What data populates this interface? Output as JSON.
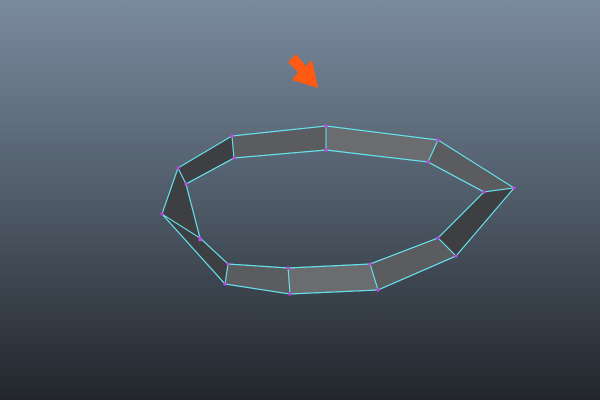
{
  "viewport": {
    "background_top": "#7A8A9E",
    "background_mid": "#4F5B68",
    "background_bottom": "#22262C"
  },
  "mesh": {
    "object": "polygon-ring",
    "segment_count": 12,
    "face_color": "#5A5C60",
    "face_shade_dark": "#3D3F42",
    "face_shade_light": "#6A6C70",
    "selected_edge_color": "#66E6F0",
    "vertex_color": "#C040E0"
  },
  "annotation": {
    "icon": "arrow-icon",
    "color": "#FF5A14"
  }
}
